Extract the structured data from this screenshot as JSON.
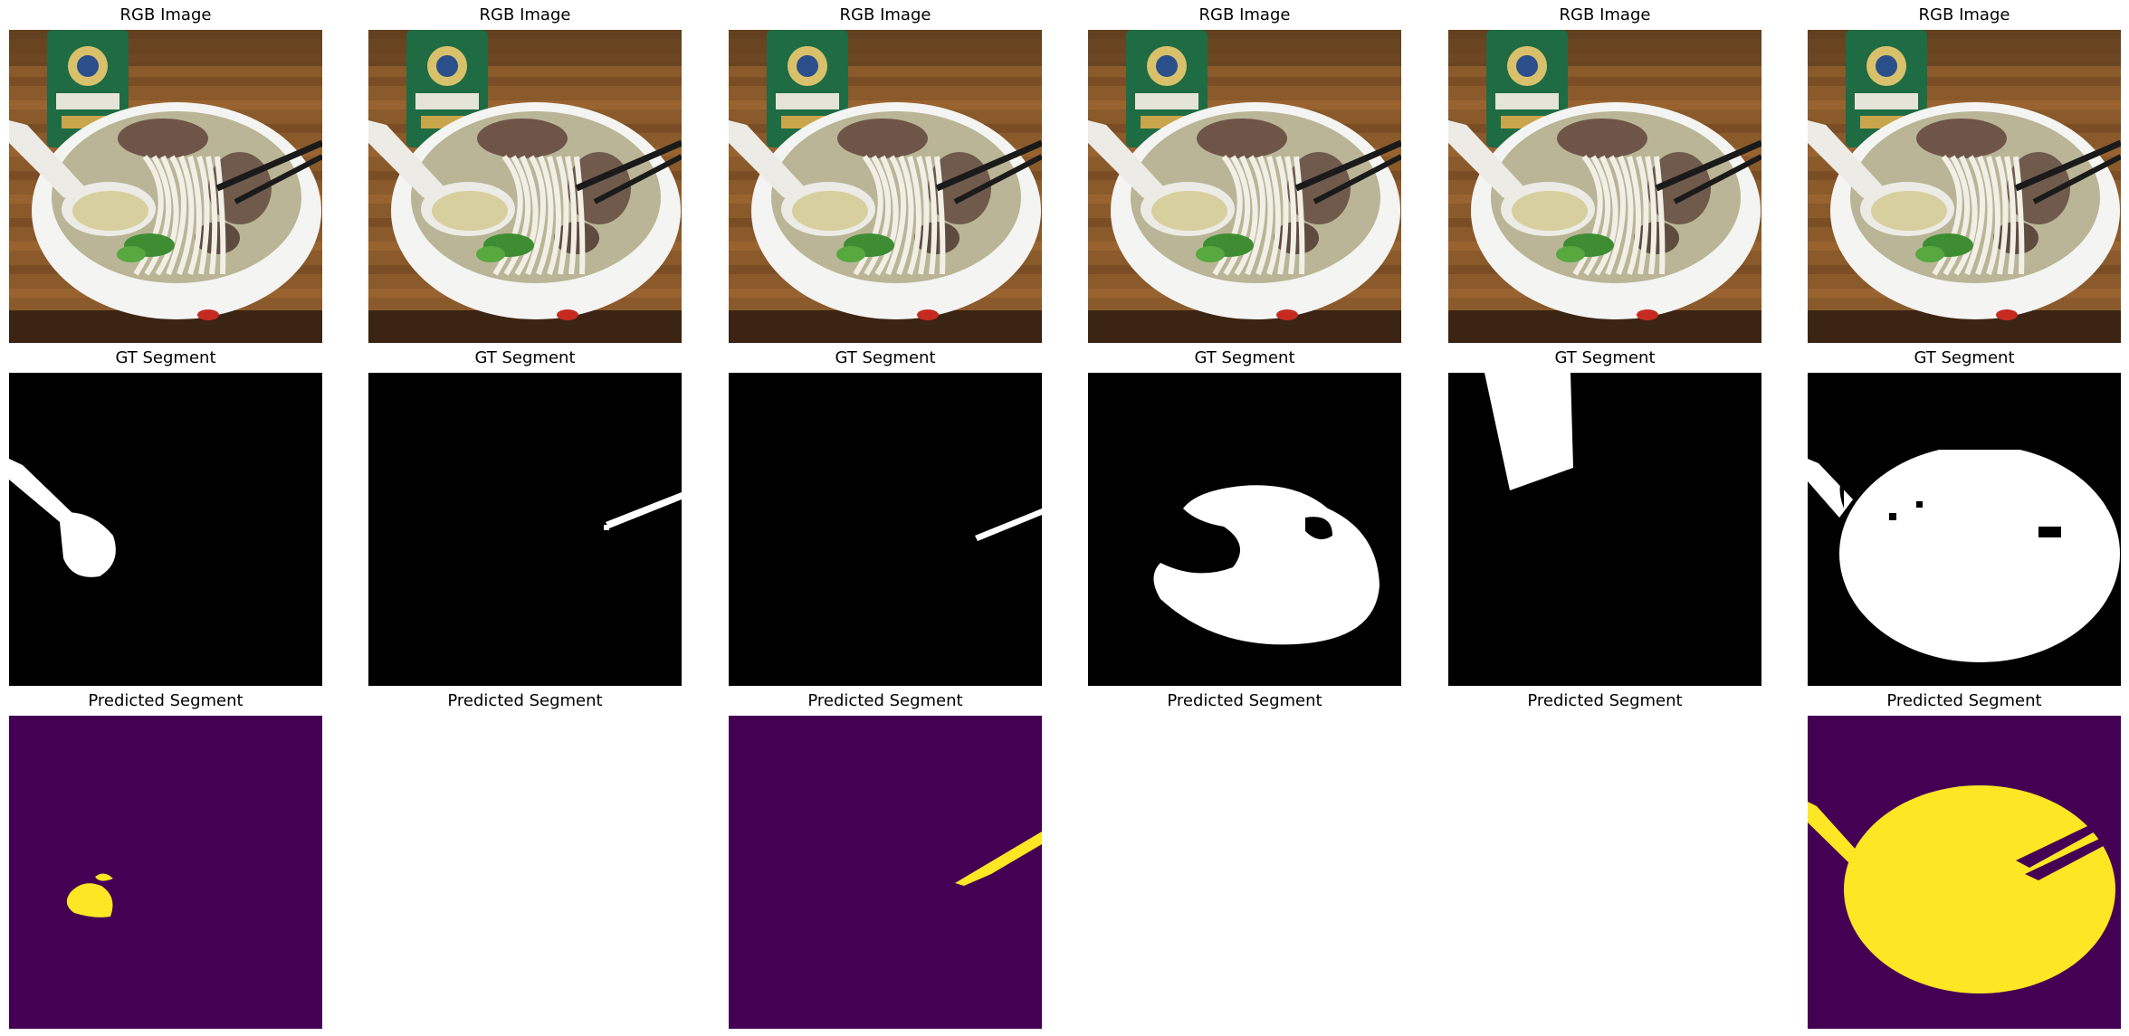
{
  "figure": {
    "rows": [
      {
        "row_id": "rgb",
        "title": "RGB Image",
        "panel_kind": "photo",
        "panels": [
          {
            "kind": "photo"
          },
          {
            "kind": "photo"
          },
          {
            "kind": "photo"
          },
          {
            "kind": "photo"
          },
          {
            "kind": "photo"
          },
          {
            "kind": "photo"
          }
        ]
      },
      {
        "row_id": "gt",
        "title": "GT Segment",
        "panel_kind": "mask",
        "panels": [
          {
            "kind": "mask",
            "object": "spoon"
          },
          {
            "kind": "mask",
            "object": "chopstick-thin"
          },
          {
            "kind": "mask",
            "object": "chopstick-thin-2"
          },
          {
            "kind": "mask",
            "object": "noodles"
          },
          {
            "kind": "mask",
            "object": "can"
          },
          {
            "kind": "mask",
            "object": "bowl"
          }
        ]
      },
      {
        "row_id": "pred",
        "title": "Predicted Segment",
        "panel_kind": "prediction",
        "panels": [
          {
            "kind": "prediction",
            "object": "spoon-blob"
          },
          {
            "kind": "empty"
          },
          {
            "kind": "prediction",
            "object": "chopstick"
          },
          {
            "kind": "empty"
          },
          {
            "kind": "empty"
          },
          {
            "kind": "prediction",
            "object": "bowl"
          }
        ]
      }
    ],
    "colors": {
      "mask_background": "#000000",
      "mask_foreground": "#ffffff",
      "pred_background": "#440154",
      "pred_foreground": "#fde725"
    },
    "labels": {
      "rgb": [
        "RGB Image",
        "RGB Image",
        "RGB Image",
        "RGB Image",
        "RGB Image",
        "RGB Image"
      ],
      "gt": [
        "GT Segment",
        "GT Segment",
        "GT Segment",
        "GT Segment",
        "GT Segment",
        "GT Segment"
      ],
      "pred": [
        "Predicted Segment",
        "Predicted Segment",
        "Predicted Segment",
        "Predicted Segment",
        "Predicted Segment",
        "Predicted Segment"
      ]
    }
  }
}
